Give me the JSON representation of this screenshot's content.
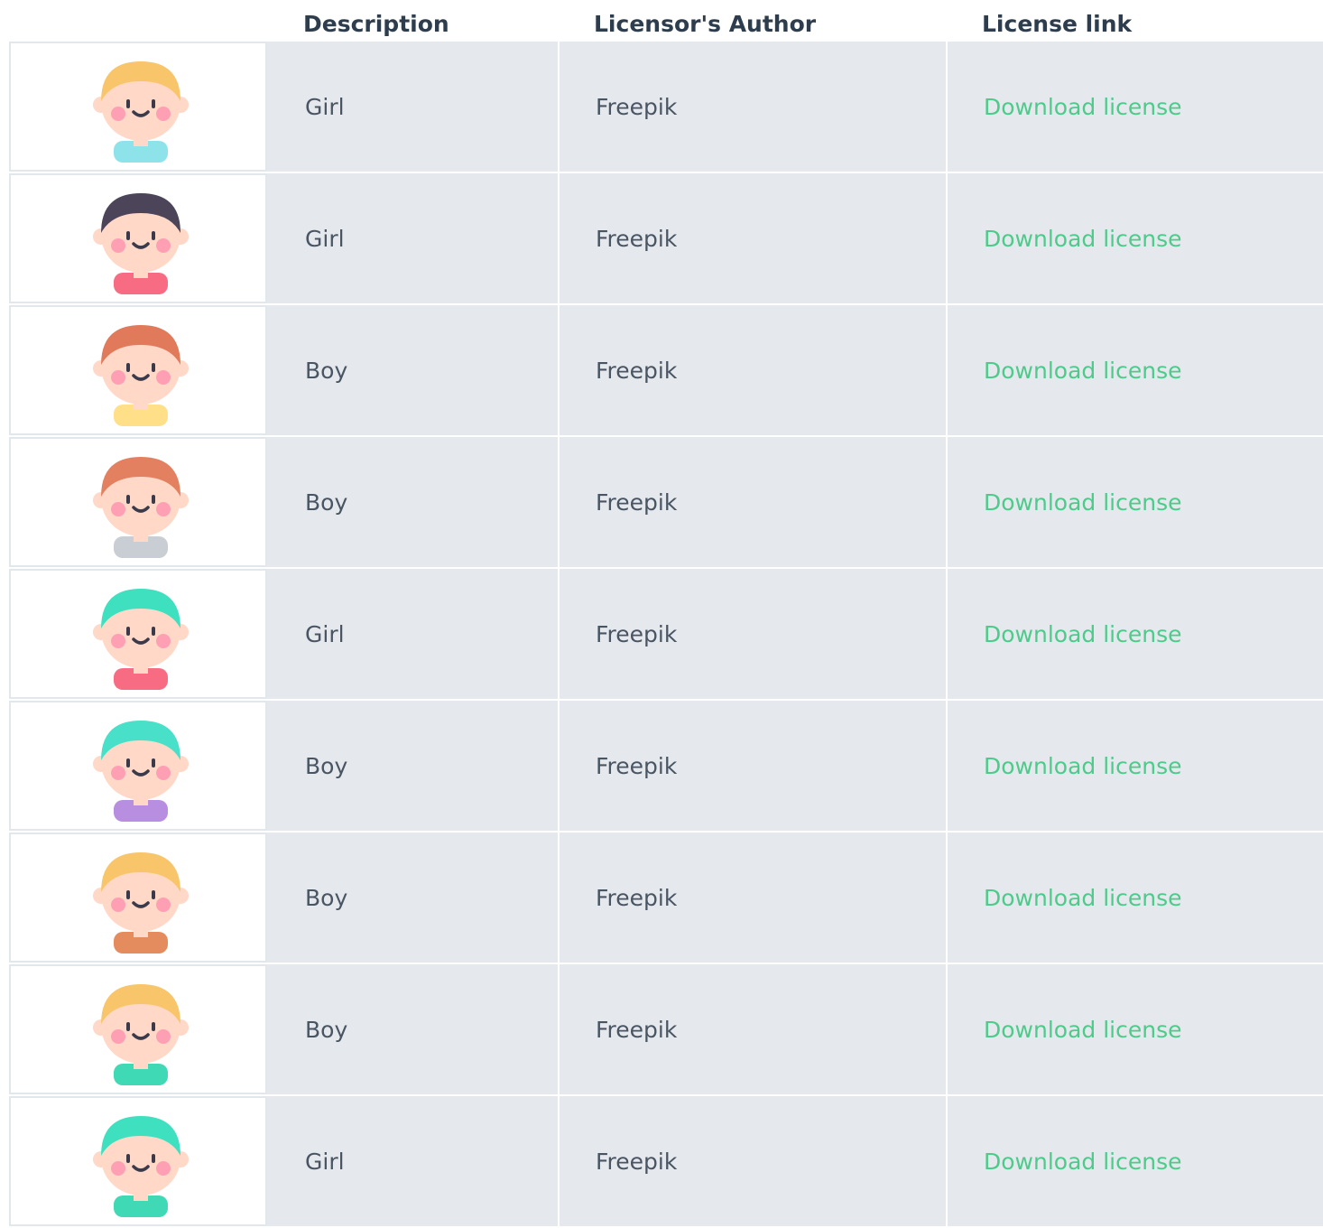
{
  "header": {
    "description": "Description",
    "author": "Licensor's Author",
    "link": "License link"
  },
  "rows": [
    {
      "description": "Girl",
      "author": "Freepik",
      "link": "Download license",
      "avatar": "blonde-girl-avatar-icon",
      "hair": "#f9c56b",
      "skin": "#ffd8c8",
      "shirt": "#8ee3ea"
    },
    {
      "description": "Girl",
      "author": "Freepik",
      "link": "Download license",
      "avatar": "glasses-girl-avatar-icon",
      "hair": "#4c4559",
      "skin": "#ffd8c8",
      "shirt": "#f76c83"
    },
    {
      "description": "Boy",
      "author": "Freepik",
      "link": "Download license",
      "avatar": "bear-hood-boy-avatar-icon",
      "hair": "#e07a5a",
      "skin": "#ffd8c8",
      "shirt": "#ffe089"
    },
    {
      "description": "Boy",
      "author": "Freepik",
      "link": "Download license",
      "avatar": "glasses-bowtie-boy-avatar-icon",
      "hair": "#e2805f",
      "skin": "#ffd8c8",
      "shirt": "#c9cdd4"
    },
    {
      "description": "Girl",
      "author": "Freepik",
      "link": "Download license",
      "avatar": "teal-hair-girl-avatar-icon",
      "hair": "#3fe0c0",
      "skin": "#ffd8c8",
      "shirt": "#f76c83"
    },
    {
      "description": "Boy",
      "author": "Freepik",
      "link": "Download license",
      "avatar": "teal-hair-boy-avatar-icon",
      "hair": "#48e0c8",
      "skin": "#ffd8c8",
      "shirt": "#b88ee0"
    },
    {
      "description": "Boy",
      "author": "Freepik",
      "link": "Download license",
      "avatar": "cap-boy-avatar-icon",
      "hair": "#f9c56b",
      "skin": "#ffd8c8",
      "shirt": "#e58c5e"
    },
    {
      "description": "Boy",
      "author": "Freepik",
      "link": "Download license",
      "avatar": "sun-hat-boy-avatar-icon",
      "hair": "#f9c56b",
      "skin": "#ffd8c8",
      "shirt": "#3fd9b6"
    },
    {
      "description": "Girl",
      "author": "Freepik",
      "link": "Download license",
      "avatar": "two-tone-hair-girl-avatar-icon",
      "hair": "#3fe0c0",
      "skin": "#ffd8c8",
      "shirt": "#3fd9b6"
    }
  ]
}
